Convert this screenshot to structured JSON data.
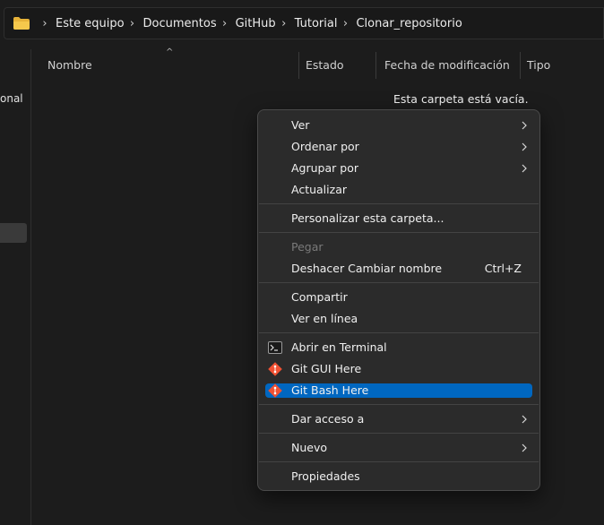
{
  "breadcrumb": {
    "icon": "folder-icon",
    "items": [
      "Este equipo",
      "Documentos",
      "GitHub",
      "Tutorial",
      "Clonar_repositorio"
    ]
  },
  "nav": {
    "cut_label": "onal"
  },
  "columns": [
    "Nombre",
    "Estado",
    "Fecha de modificación",
    "Tipo"
  ],
  "empty_message": "Esta carpeta está vacía.",
  "context_menu": {
    "ver": "Ver",
    "ordenar": "Ordenar por",
    "agrupar": "Agrupar por",
    "actualizar": "Actualizar",
    "personalizar": "Personalizar esta carpeta...",
    "pegar": "Pegar",
    "deshacer": "Deshacer Cambiar nombre",
    "deshacer_shortcut": "Ctrl+Z",
    "compartir": "Compartir",
    "ver_linea": "Ver en línea",
    "terminal": "Abrir en Terminal",
    "git_gui": "Git GUI Here",
    "git_bash": "Git Bash Here",
    "dar_acceso": "Dar acceso a",
    "nuevo": "Nuevo",
    "propiedades": "Propiedades",
    "highlighted_item": "Git Bash Here"
  },
  "colors": {
    "accent": "#0067c0",
    "folder": "#e8b339",
    "git": "#f05133"
  }
}
